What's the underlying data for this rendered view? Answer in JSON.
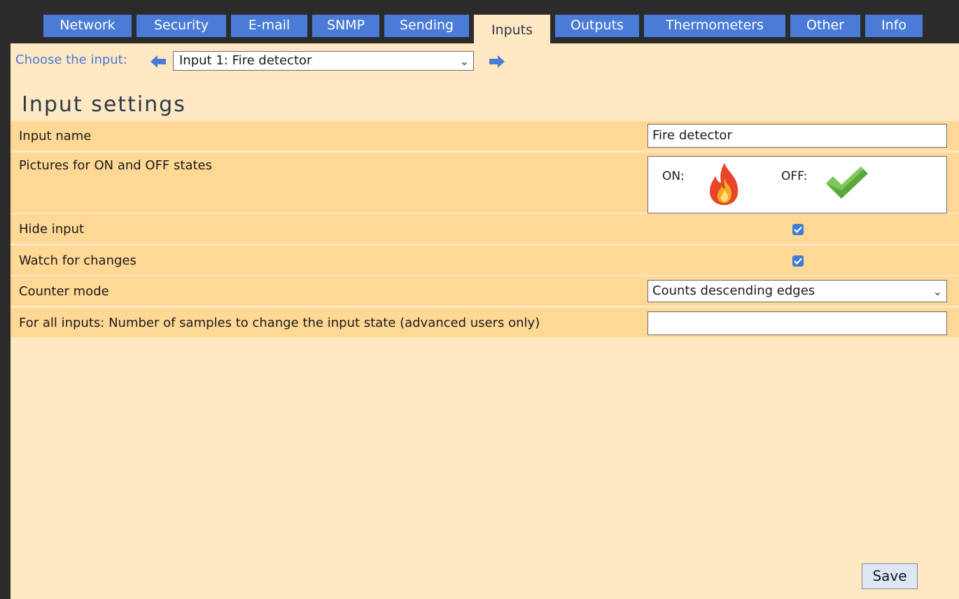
{
  "tabs": [
    {
      "label": "Network",
      "active": false
    },
    {
      "label": "Security",
      "active": false
    },
    {
      "label": "E-mail",
      "active": false
    },
    {
      "label": "SNMP",
      "active": false
    },
    {
      "label": "Sending",
      "active": false
    },
    {
      "label": "Inputs",
      "active": true
    },
    {
      "label": "Outputs",
      "active": false
    },
    {
      "label": "Thermometers",
      "active": false
    },
    {
      "label": "Other",
      "active": false
    },
    {
      "label": "Info",
      "active": false
    }
  ],
  "chooser": {
    "label": "Choose the input:",
    "selected": "Input 1: Fire detector",
    "prev_icon": "arrow-left-icon",
    "next_icon": "arrow-right-icon"
  },
  "page_title": "Input settings",
  "settings": {
    "input_name": {
      "label": "Input name",
      "value": "Fire detector"
    },
    "pictures": {
      "label": "Pictures for ON and OFF states",
      "on_label": "ON:",
      "off_label": "OFF:",
      "on_icon": "fire-icon",
      "off_icon": "checkmark-icon"
    },
    "hide_input": {
      "label": "Hide input",
      "checked": true
    },
    "watch_changes": {
      "label": "Watch for changes",
      "checked": true
    },
    "counter_mode": {
      "label": "Counter mode",
      "selected": "Counts descending edges"
    },
    "samples": {
      "label": "For all inputs: Number of samples to change the input state (advanced users only)",
      "value": ""
    }
  },
  "save_label": "Save",
  "colors": {
    "tab_blue": "#4a7bd6",
    "background": "#ffe8c2",
    "row_highlight": "#ffd896",
    "frame": "#2b2b2b"
  }
}
